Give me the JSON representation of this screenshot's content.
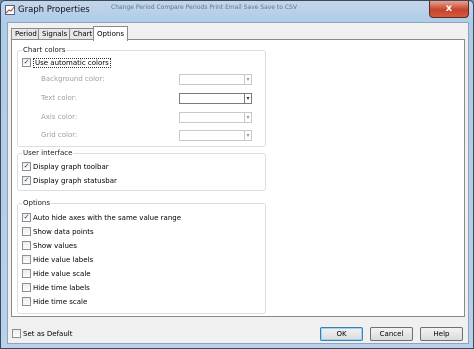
{
  "window": {
    "title": "Graph Properties",
    "close_symbol": "x",
    "background_text": "Change Period  Compare Periods  Print  Email  Save  Save to CSV"
  },
  "tabs": [
    {
      "label": "Period"
    },
    {
      "label": "Signals"
    },
    {
      "label": "Chart"
    },
    {
      "label": "Options"
    }
  ],
  "chart_colors": {
    "title": "Chart colors",
    "auto_label": "Use automatic colors",
    "auto_checked": true,
    "background_label": "Background color:",
    "text_label": "Text color:",
    "axis_label": "Axis color:",
    "grid_label": "Grid color:",
    "dropdown_arrow": "▾"
  },
  "user_interface": {
    "title": "User interface",
    "items": [
      {
        "label": "Display graph toolbar",
        "checked": true
      },
      {
        "label": "Display graph statusbar",
        "checked": true
      }
    ]
  },
  "options": {
    "title": "Options",
    "items": [
      {
        "label": "Auto hide axes with the same value range",
        "checked": true
      },
      {
        "label": "Show data points",
        "checked": false
      },
      {
        "label": "Show values",
        "checked": false
      },
      {
        "label": "Hide value labels",
        "checked": false
      },
      {
        "label": "Hide value scale",
        "checked": false
      },
      {
        "label": "Hide time labels",
        "checked": false
      },
      {
        "label": "Hide time scale",
        "checked": false
      }
    ]
  },
  "footer": {
    "set_default_label": "Set as Default",
    "ok_label": "OK",
    "cancel_label": "Cancel",
    "help_label": "Help"
  },
  "check_mark": "✓"
}
